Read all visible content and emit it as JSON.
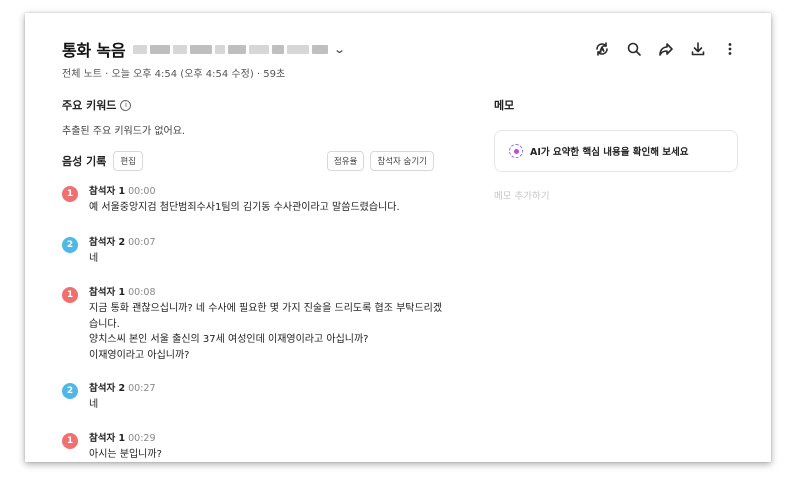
{
  "header": {
    "title": "통화 녹음",
    "meta": "전체 노트 · 오늘 오후 4:54 (오후 4:54 수정) · 59초"
  },
  "toolbar": {
    "icons": [
      "ai-summary-icon",
      "search-icon",
      "share-icon",
      "download-icon",
      "more-icon"
    ]
  },
  "keywords": {
    "title": "주요 키워드",
    "info": "i",
    "empty": "추출된 주요 키워드가 없어요."
  },
  "recording": {
    "title": "음성 기록",
    "edit": "편집",
    "share": "점유율",
    "hide_speakers": "참석자 숨기기",
    "entries": [
      {
        "num": "1",
        "speaker": "참석자 1",
        "time": "00:00",
        "text": "예 서울중앙지검 첨단범죄수사1팀의 김기동 수사관이라고 말씀드렸습니다."
      },
      {
        "num": "2",
        "speaker": "참석자 2",
        "time": "00:07",
        "text": "네"
      },
      {
        "num": "1",
        "speaker": "참석자 1",
        "time": "00:08",
        "text": "지금 통화 괜찮으십니까? 네 수사에 필요한 몇 가지 진술을 드리도록 협조 부탁드리겠습니다.\n양치스씨 본인 서울 출신의 37세 여성인데 이재영이라고 아십니까?\n이재영이라고 아십니까?"
      },
      {
        "num": "2",
        "speaker": "참석자 2",
        "time": "00:27",
        "text": "네"
      },
      {
        "num": "1",
        "speaker": "참석자 1",
        "time": "00:29",
        "text": "아시는 분입니까?"
      }
    ]
  },
  "memo": {
    "title": "메모",
    "ai_prompt": "AI가 요약한 핵심 내용을 확인해 보세요",
    "add_placeholder": "메모 추가하기"
  },
  "colors": {
    "speaker1": "#f07070",
    "speaker2": "#4fb8e6",
    "ai_accent": "#9a6cf0"
  }
}
